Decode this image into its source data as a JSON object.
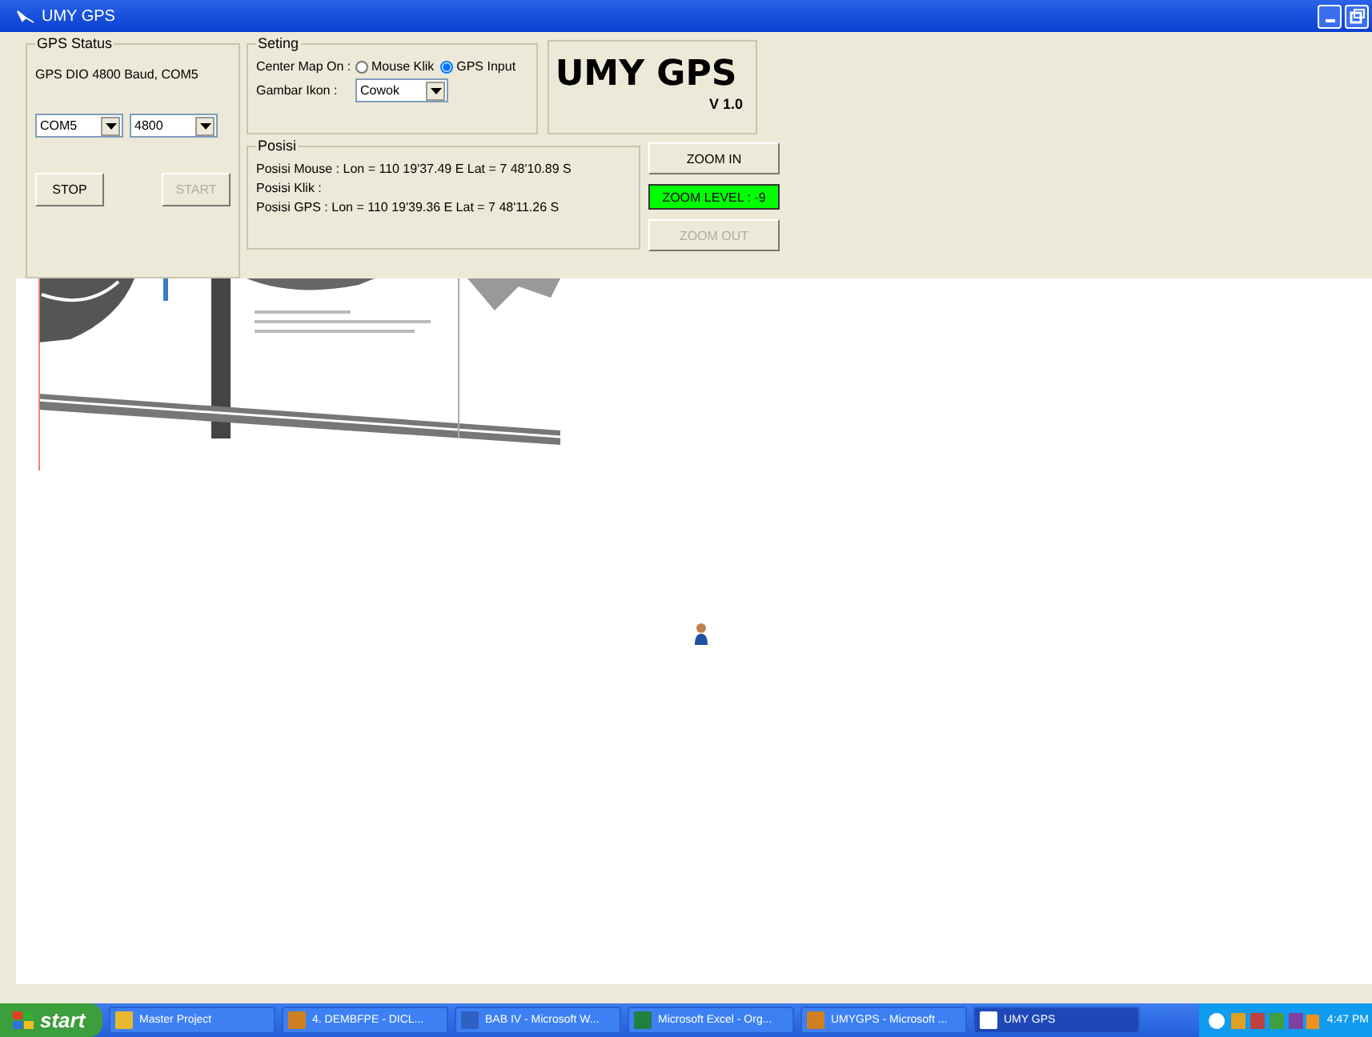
{
  "window": {
    "title": "UMY GPS"
  },
  "gps_status": {
    "title": "GPS Status",
    "info": "GPS DIO 4800 Baud, COM5",
    "port": "COM5",
    "baud": "4800",
    "buttons": [
      {
        "label": "STOP",
        "disabled": false
      },
      {
        "label": "START",
        "disabled": true
      }
    ]
  },
  "setting": {
    "title": "Seting",
    "center_label": "Center Map On :",
    "radios": [
      {
        "label": "Mouse Klik",
        "selected": false
      },
      {
        "label": "GPS Input",
        "selected": true
      }
    ],
    "icon_label": "Gambar Ikon :",
    "icon_value": "Cowok"
  },
  "logo": {
    "title": "UMY GPS",
    "version": "V 1.0"
  },
  "posisi": {
    "title": "Posisi",
    "lines": [
      "Posisi Mouse : Lon = 110 19'37.49 E Lat = 7 48'10.89 S",
      "Posisi Klik :",
      "Posisi GPS : Lon = 110 19'39.36 E Lat = 7 48'11.26 S"
    ]
  },
  "zoom": {
    "zoom_in": {
      "label": "ZOOM IN",
      "disabled": false
    },
    "level_label": "ZOOM LEVEL : -9",
    "zoom_out": {
      "label": "ZOOM OUT",
      "disabled": true
    }
  },
  "taskbar": {
    "start": "start",
    "items": [
      {
        "label": "Master Project",
        "selected": false
      },
      {
        "label": "4. DEMBFPE - DICL...",
        "selected": false
      },
      {
        "label": "BAB IV - Microsoft W...",
        "selected": false
      },
      {
        "label": "Microsoft Excel - Org...",
        "selected": false
      },
      {
        "label": "UMYGPS - Microsoft ...",
        "selected": false
      },
      {
        "label": "UMY GPS",
        "selected": true
      }
    ],
    "clock": "4:47 PM"
  }
}
